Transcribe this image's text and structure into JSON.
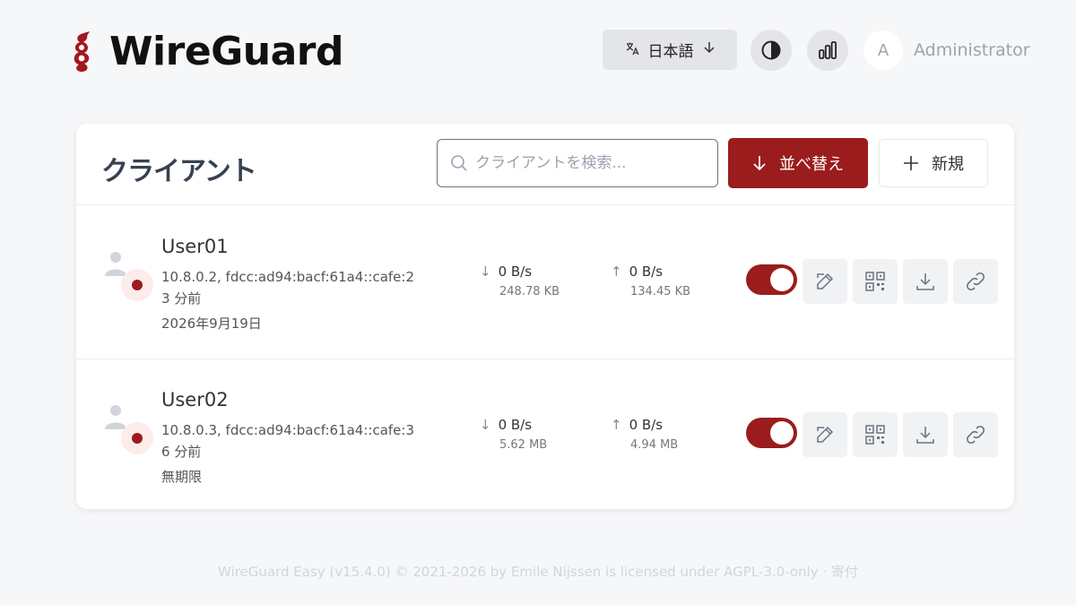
{
  "app": {
    "title": "WireGuard"
  },
  "header": {
    "language_label": "日本語",
    "user_initial": "A",
    "user_name": "Administrator"
  },
  "colors": {
    "accent": "#9b1c1c",
    "background": "#f6f7f9"
  },
  "clients_panel": {
    "title": "クライアント",
    "search_placeholder": "クライアントを検索...",
    "search_value": "",
    "sort_label": "並べ替え",
    "new_label": "新規"
  },
  "clients": [
    {
      "name": "User01",
      "address": "10.8.0.2, fdcc:ad94:bacf:61a4::cafe:2",
      "last_seen": "3 分前",
      "expiry": "2026年9月19日",
      "rx_rate": "0 B/s",
      "rx_total": "248.78 KB",
      "tx_rate": "0 B/s",
      "tx_total": "134.45 KB",
      "enabled": true
    },
    {
      "name": "User02",
      "address": "10.8.0.3, fdcc:ad94:bacf:61a4::cafe:3",
      "last_seen": "6 分前",
      "expiry": "無期限",
      "rx_rate": "0 B/s",
      "rx_total": "5.62 MB",
      "tx_rate": "0 B/s",
      "tx_total": "4.94 MB",
      "enabled": true
    }
  ],
  "footer": {
    "text": "WireGuard Easy (v15.4.0) © 2021-2026 by Emile Nijssen is licensed under AGPL-3.0-only",
    "separator": " · ",
    "donate_label": "寄付"
  },
  "icons": {
    "logo": "wireguard-dragon-icon",
    "language": "translate-icon",
    "theme": "contrast-icon",
    "stats": "bar-chart-icon",
    "search": "search-icon",
    "sort": "arrow-down-icon",
    "new": "plus-icon",
    "edit": "edit-icon",
    "qr": "qr-code-icon",
    "download": "download-icon",
    "link": "link-icon"
  }
}
